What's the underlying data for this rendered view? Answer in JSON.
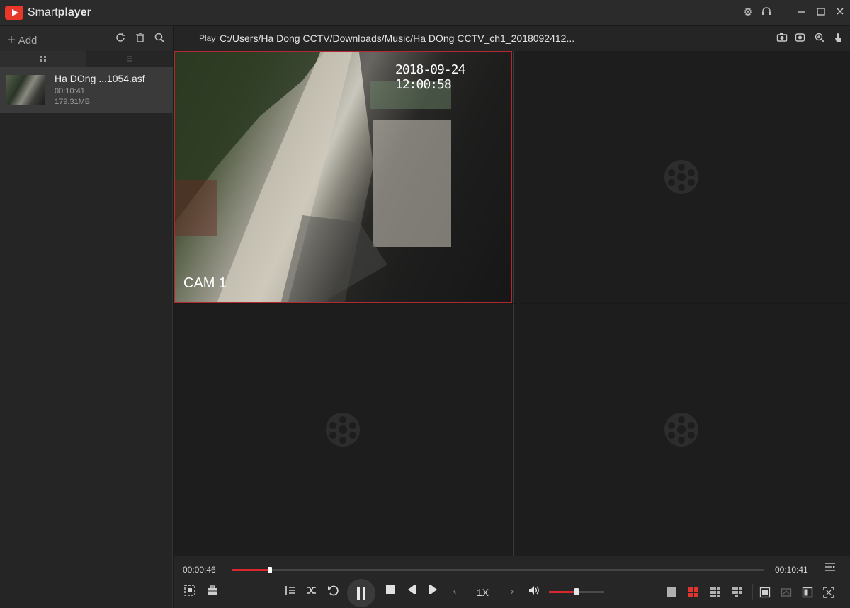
{
  "app": {
    "title_light": "Smart",
    "title_bold": "player"
  },
  "titlebar_icons": [
    "gear-icon",
    "headset-icon",
    "minimize-icon",
    "maximize-icon",
    "close-icon"
  ],
  "sidebar": {
    "add_label": "Add",
    "toolbar_icons": [
      "refresh-icon",
      "trash-icon",
      "search-icon"
    ],
    "files": [
      {
        "name": "Ha DOng ...1054.asf",
        "duration": "00:10:41",
        "size": "179.31MB"
      }
    ]
  },
  "pathbar": {
    "play_label": "Play",
    "path": "C:/Users/Ha Dong CCTV/Downloads/Music/Ha DOng CCTV_ch1_2018092412...",
    "icons": [
      "snapshot-icon",
      "record-icon",
      "zoom-icon",
      "hand-icon"
    ]
  },
  "video": {
    "timestamp": "2018-09-24 12:00:58",
    "camera_label": "CAM 1"
  },
  "playback": {
    "current_time": "00:00:46",
    "total_time": "00:10:41",
    "progress": 0.072,
    "speed": "1X",
    "volume": 0.5
  },
  "colors": {
    "accent": "#d8272d",
    "active_border": "#b12a2f"
  }
}
